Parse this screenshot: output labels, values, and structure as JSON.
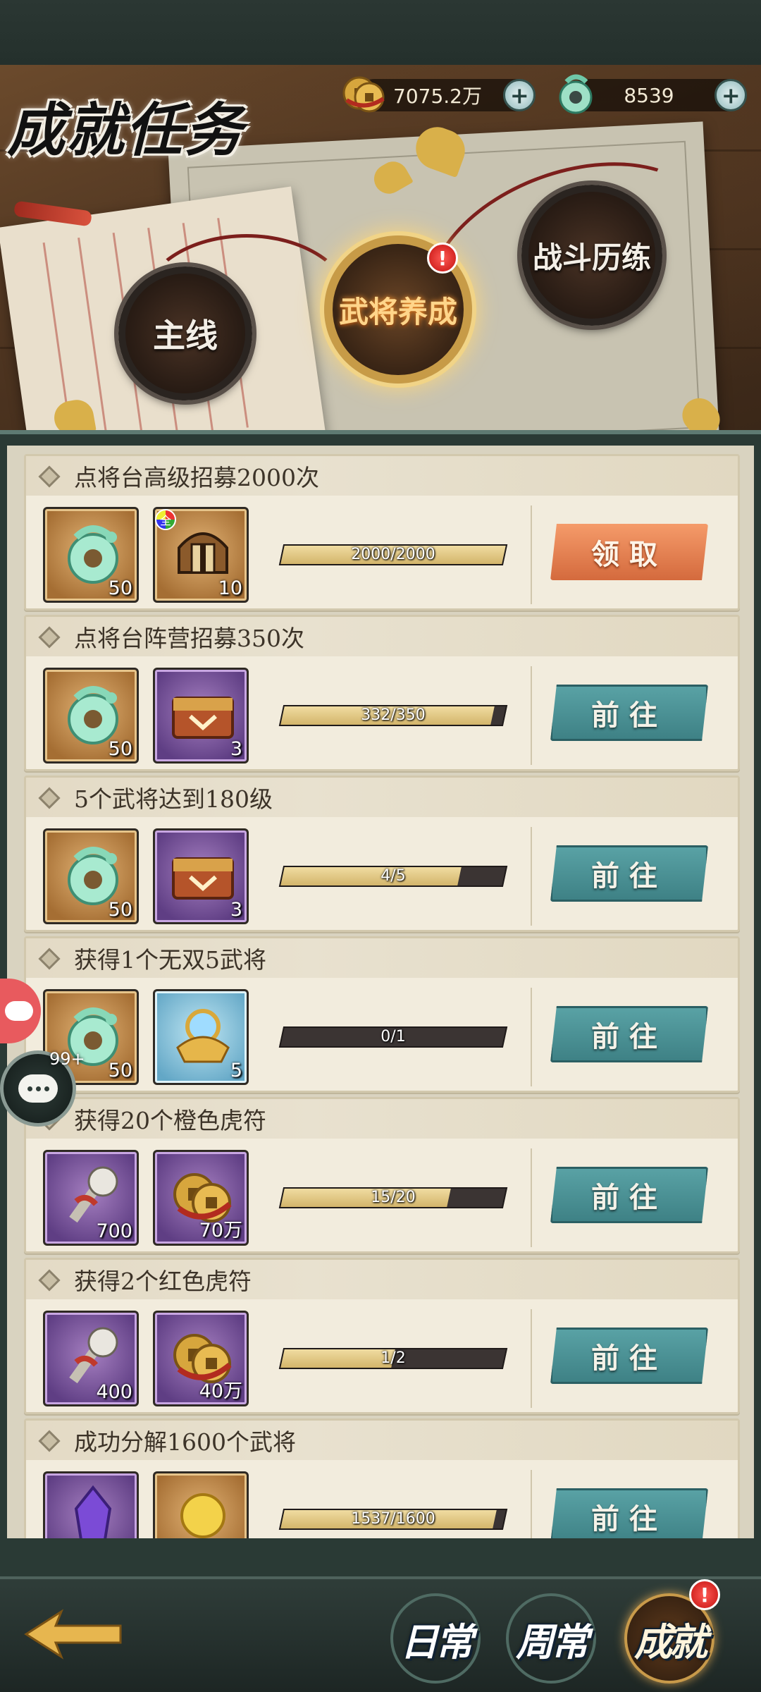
{
  "header": {
    "title": "成就任务",
    "currencies": [
      {
        "icon": "coin-icon",
        "amount": "7075.2万"
      },
      {
        "icon": "jade-icon",
        "amount": "8539"
      }
    ],
    "categories": [
      {
        "label": "主线",
        "active": false,
        "badge": false
      },
      {
        "label": "武将养成",
        "active": true,
        "badge": true
      },
      {
        "label": "战斗历练",
        "active": false,
        "badge": false
      }
    ],
    "badge_mark": "!"
  },
  "tasks": [
    {
      "title": "点将台高级招募2000次",
      "rewards": [
        {
          "icon": "jade-icon",
          "qty": "50",
          "rarity": "orange"
        },
        {
          "icon": "helmet-fragment-icon",
          "qty": "10",
          "rarity": "orange",
          "tag": "全"
        }
      ],
      "progress_text": "2000/2000",
      "progress": 1.0,
      "button": "领取",
      "button_style": "orange"
    },
    {
      "title": "点将台阵营招募350次",
      "rewards": [
        {
          "icon": "jade-icon",
          "qty": "50",
          "rarity": "orange"
        },
        {
          "icon": "chest-icon",
          "qty": "3",
          "rarity": "purple"
        }
      ],
      "progress_text": "332/350",
      "progress": 0.9486,
      "button": "前往",
      "button_style": "teal"
    },
    {
      "title": "5个武将达到180级",
      "rewards": [
        {
          "icon": "jade-icon",
          "qty": "50",
          "rarity": "orange"
        },
        {
          "icon": "chest-icon",
          "qty": "3",
          "rarity": "purple"
        }
      ],
      "progress_text": "4/5",
      "progress": 0.8,
      "button": "前往",
      "button_style": "teal"
    },
    {
      "title": "获得1个无双5武将",
      "rewards": [
        {
          "icon": "jade-icon",
          "qty": "50",
          "rarity": "orange"
        },
        {
          "icon": "golden-crest-icon",
          "qty": "5",
          "rarity": "blue"
        }
      ],
      "progress_text": "0/1",
      "progress": 0.0,
      "button": "前往",
      "button_style": "teal"
    },
    {
      "title": "获得20个橙色虎符",
      "rewards": [
        {
          "icon": "tiger-tally-icon",
          "qty": "700",
          "rarity": "purple"
        },
        {
          "icon": "coin-icon",
          "qty": "70万",
          "rarity": "purple"
        }
      ],
      "progress_text": "15/20",
      "progress": 0.75,
      "button": "前往",
      "button_style": "teal"
    },
    {
      "title": "获得2个红色虎符",
      "rewards": [
        {
          "icon": "tiger-tally-icon",
          "qty": "400",
          "rarity": "purple"
        },
        {
          "icon": "coin-icon",
          "qty": "40万",
          "rarity": "purple"
        }
      ],
      "progress_text": "1/2",
      "progress": 0.5,
      "button": "前往",
      "button_style": "teal"
    },
    {
      "title": "成功分解1600个武将",
      "rewards": [
        {
          "icon": "crystal-icon",
          "qty": "",
          "rarity": "purple"
        },
        {
          "icon": "gold-orb-icon",
          "qty": "",
          "rarity": "orange"
        }
      ],
      "progress_text": "1537/1600",
      "progress": 0.96,
      "button": "前往",
      "button_style": "teal"
    }
  ],
  "floating": {
    "chat_count": "99+"
  },
  "bottom_nav": {
    "tabs": [
      {
        "label": "日常",
        "active": false
      },
      {
        "label": "周常",
        "active": false
      },
      {
        "label": "成就",
        "active": true,
        "badge": true
      }
    ]
  }
}
